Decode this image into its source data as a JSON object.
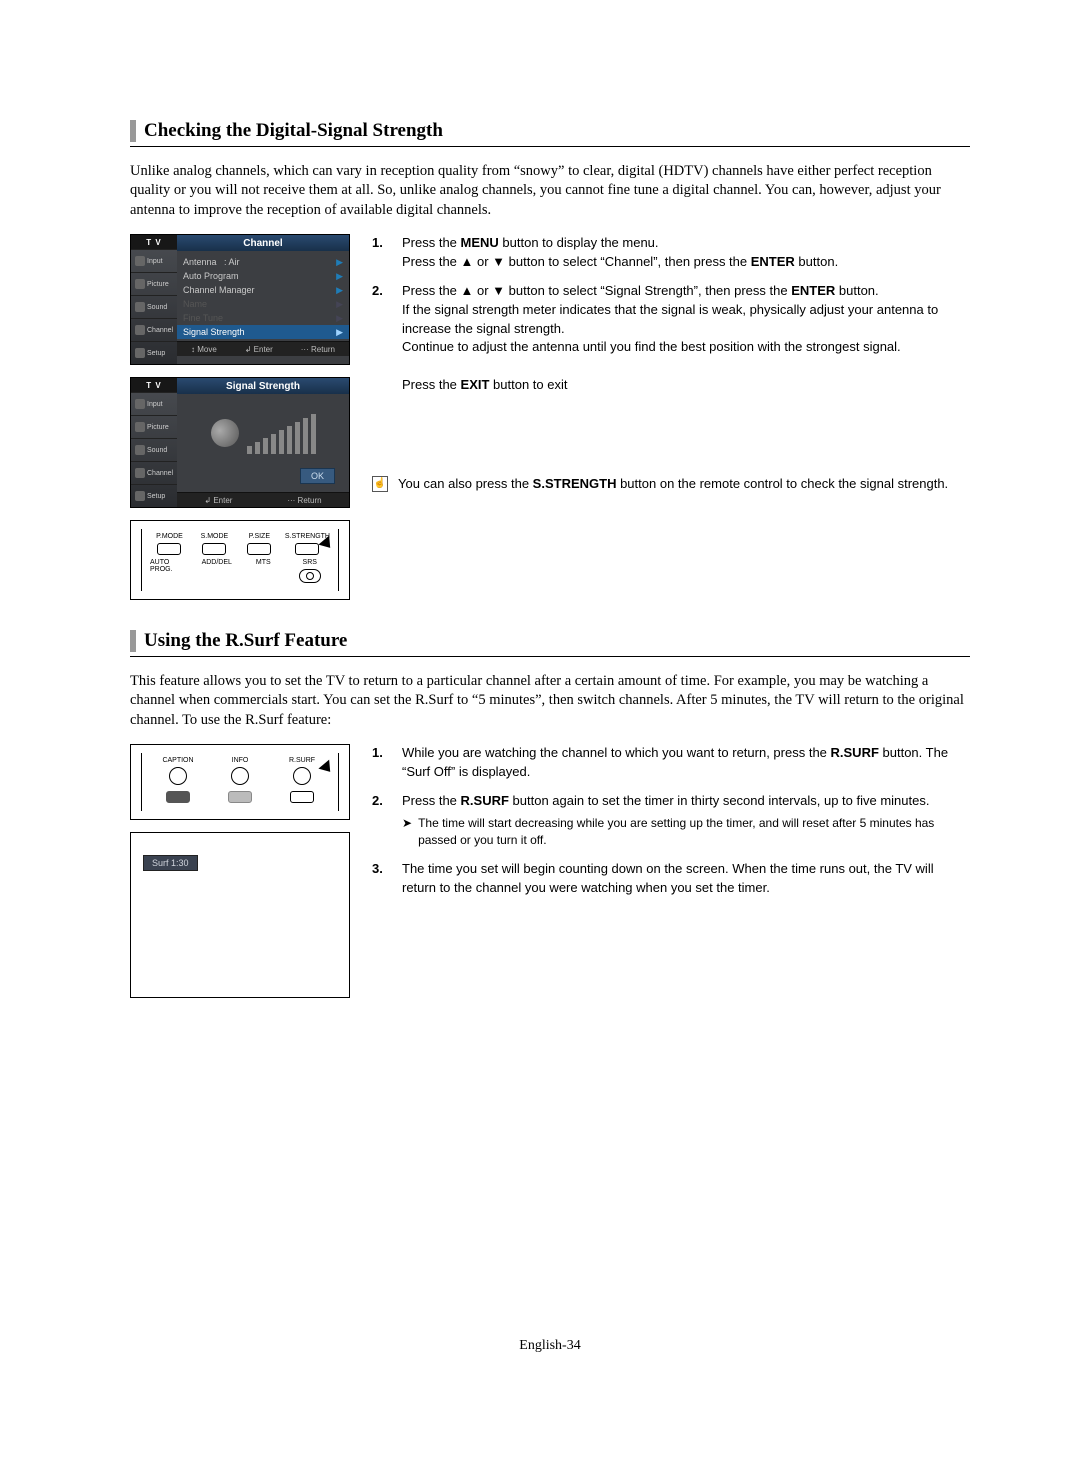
{
  "section1": {
    "title": "Checking the Digital-Signal Strength",
    "intro": "Unlike analog channels, which can vary in reception quality from “snowy” to clear, digital (HDTV) channels have either perfect reception quality or you will not receive them at all. So, unlike analog channels, you cannot fine tune a digital channel. You can, however, adjust your antenna to improve the reception of available digital channels.",
    "steps": {
      "s1a": "Press the ",
      "s1b": "MENU",
      "s1c": " button to display the menu.",
      "s1d": "Press the ▲ or ▼ button to select “Channel”, then press the ",
      "s1e": "ENTER",
      "s1f": " button.",
      "s2a": "Press the ▲ or ▼ button to select “Signal Strength”, then press the ",
      "s2b": "ENTER",
      "s2c": " button.",
      "s2d": "If the signal strength meter indicates that the signal is weak, physically adjust your antenna to increase the signal strength.",
      "s2e": "Continue to adjust the antenna until you find the best position with the strongest signal.",
      "s2f_a": "Press the ",
      "s2f_b": "EXIT",
      "s2f_c": " button to exit"
    },
    "note_a": "You can also press the ",
    "note_b": "S.STRENGTH",
    "note_c": " button on the remote control to check the signal strength."
  },
  "osd1": {
    "tv": "T V",
    "side": [
      "Input",
      "Picture",
      "Sound",
      "Channel",
      "Setup"
    ],
    "head": "Channel",
    "items": [
      {
        "label": "Antenna",
        "value": ": Air",
        "dim": false
      },
      {
        "label": "Auto Program",
        "value": "",
        "dim": false
      },
      {
        "label": "Channel Manager",
        "value": "",
        "dim": false
      },
      {
        "label": "Name",
        "value": "",
        "dim": true
      },
      {
        "label": "Fine Tune",
        "value": "",
        "dim": true
      },
      {
        "label": "Signal Strength",
        "value": "",
        "sel": true
      }
    ],
    "foot": [
      "↕ Move",
      "↲ Enter",
      "··· Return"
    ]
  },
  "osd2": {
    "tv": "T V",
    "side": [
      "Input",
      "Picture",
      "Sound",
      "Channel",
      "Setup"
    ],
    "head": "Signal Strength",
    "ok": "OK",
    "foot": [
      "↲ Enter",
      "··· Return"
    ]
  },
  "remote1": {
    "row1": [
      "P.MODE",
      "S.MODE",
      "P.SIZE",
      "S.STRENGTH"
    ],
    "row2": [
      "AUTO PROG.",
      "ADD/DEL",
      "MTS",
      "SRS"
    ]
  },
  "section2": {
    "title": "Using the R.Surf Feature",
    "intro": "This feature allows you to set the TV to return to a particular channel after a certain amount of time. For example, you may be watching a channel when commercials start. You can set the R.Surf to “5 minutes”, then switch channels. After 5 minutes, the TV will return to the original channel. To use the R.Surf feature:",
    "steps": {
      "s1a": "While you are watching the channel to which you want to return, press the ",
      "s1b": "R.SURF",
      "s1c": " button. The “Surf Off” is displayed.",
      "s2a": "Press the ",
      "s2b": "R.SURF",
      "s2c": " button again to set the timer in thirty second intervals, up to five minutes.",
      "s2note": "The time will start decreasing while you are setting up the timer, and will reset after 5 minutes has passed or you turn it off.",
      "s3": "The time you set will begin counting down on the screen. When the time runs out, the TV will return to the channel you were watching when you set the timer."
    }
  },
  "remote2": {
    "row1": [
      "CAPTION",
      "INFO",
      "R.SURF"
    ]
  },
  "surf_chip": "Surf  1:30",
  "page_num": "English-34"
}
